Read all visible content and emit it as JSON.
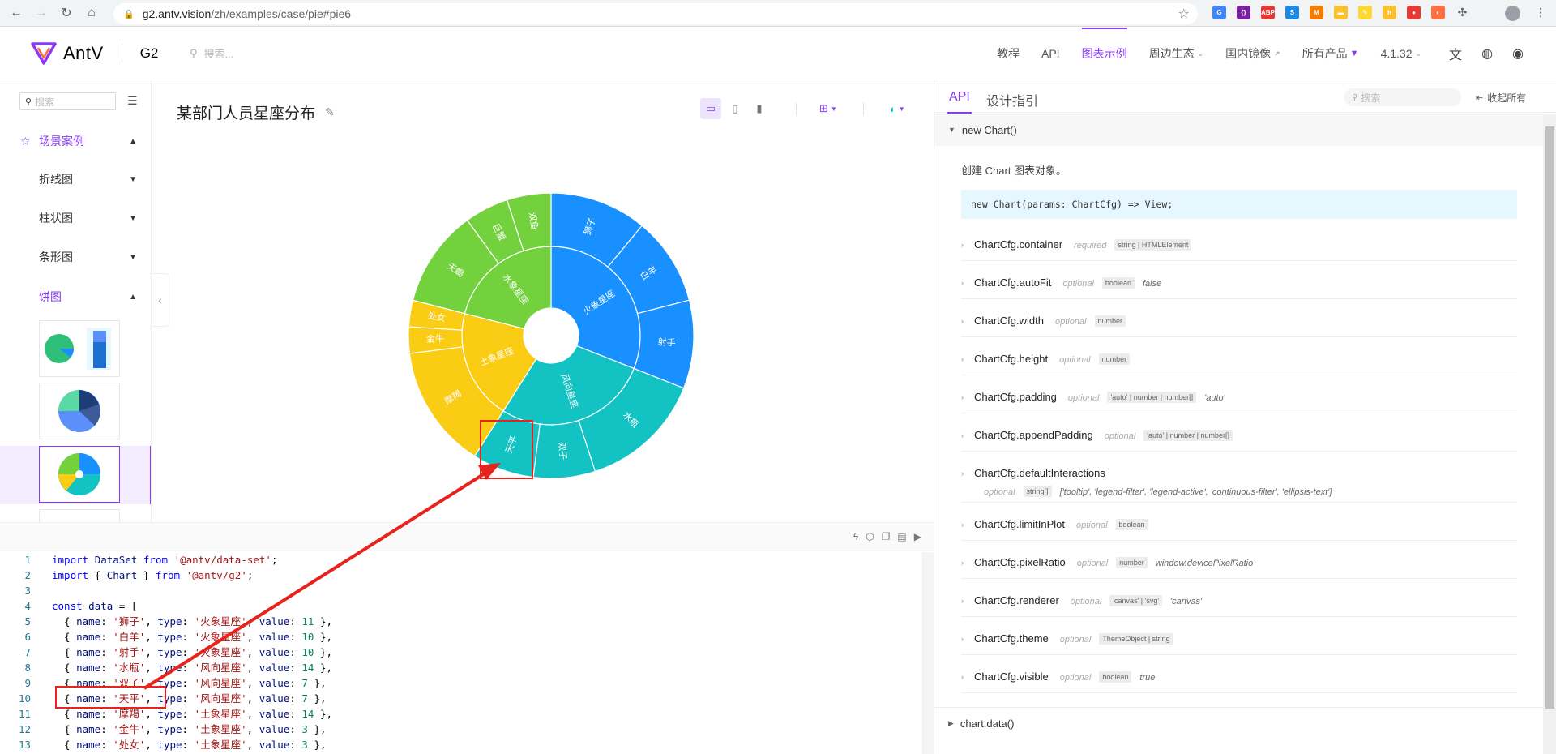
{
  "browser": {
    "url_host": "g2.antv.vision",
    "url_path": "/zh/examples/case/pie#pie6",
    "extensions": [
      {
        "name": "translate-ext",
        "color": "#4285f4",
        "label": "G"
      },
      {
        "name": "json-ext",
        "color": "#7b1fa2",
        "label": "{}"
      },
      {
        "name": "adblock-ext",
        "color": "#e53935",
        "label": "ABP"
      },
      {
        "name": "screenshot-ext",
        "color": "#1e88e5",
        "label": "S"
      },
      {
        "name": "metamask-ext",
        "color": "#f57c00",
        "label": "M"
      },
      {
        "name": "tab-ext",
        "color": "#fbc02d",
        "label": "▬"
      },
      {
        "name": "pen-ext",
        "color": "#fdd835",
        "label": "✎"
      },
      {
        "name": "code-ext",
        "color": "#fbc02d",
        "label": "h"
      },
      {
        "name": "dice-ext",
        "color": "#e53935",
        "label": "●"
      },
      {
        "name": "chart-ext",
        "color": "#ff7043",
        "label": "◐"
      }
    ]
  },
  "header": {
    "brand": "AntV",
    "product": "G2",
    "search_placeholder": "搜索...",
    "nav": [
      {
        "label": "教程",
        "active": false
      },
      {
        "label": "API",
        "active": false
      },
      {
        "label": "图表示例",
        "active": true
      },
      {
        "label": "周边生态",
        "active": false,
        "dropdown": true
      },
      {
        "label": "国内镜像",
        "active": false,
        "external": true
      },
      {
        "label": "所有产品",
        "active": false,
        "badge": true
      },
      {
        "label": "4.1.32",
        "active": false,
        "dropdown": true
      }
    ]
  },
  "sidebar": {
    "search_placeholder": "搜索",
    "root": "场景案例",
    "groups": [
      "折线图",
      "柱状图",
      "条形图"
    ],
    "open_group": "饼图"
  },
  "demo": {
    "title": "某部门人员星座分布"
  },
  "chart_data": {
    "type": "pie",
    "inner": [
      {
        "name": "火象星座",
        "value": 31,
        "color": "#1890ff"
      },
      {
        "name": "风向星座",
        "value": 28,
        "color": "#13c2c2"
      },
      {
        "name": "土象星座",
        "value": 20,
        "color": "#facc14"
      },
      {
        "name": "水象星座",
        "value": 21,
        "color": "#73d13d"
      }
    ],
    "outer": [
      {
        "name": "狮子",
        "type": "火象星座",
        "value": 11
      },
      {
        "name": "白羊",
        "type": "火象星座",
        "value": 10
      },
      {
        "name": "射手",
        "type": "火象星座",
        "value": 10
      },
      {
        "name": "水瓶",
        "type": "风向星座",
        "value": 14
      },
      {
        "name": "双子",
        "type": "风向星座",
        "value": 7
      },
      {
        "name": "天平",
        "type": "风向星座",
        "value": 7
      },
      {
        "name": "摩羯",
        "type": "土象星座",
        "value": 14
      },
      {
        "name": "金牛",
        "type": "土象星座",
        "value": 3
      },
      {
        "name": "处女",
        "type": "土象星座",
        "value": 3
      },
      {
        "name": "天蝎",
        "type": "水象星座",
        "value": 11
      },
      {
        "name": "巨蟹",
        "type": "水象星座",
        "value": 5
      },
      {
        "name": "双鱼",
        "type": "水象星座",
        "value": 5
      }
    ]
  },
  "code": {
    "lines": [
      {
        "n": "1",
        "html": "<span class='kw'>import</span> <span class='prop'>DataSet</span> <span class='kw'>from</span> <span class='str'>'@antv/data-set'</span>;"
      },
      {
        "n": "2",
        "html": "<span class='kw'>import</span> { <span class='prop'>Chart</span> } <span class='kw'>from</span> <span class='str'>'@antv/g2'</span>;"
      },
      {
        "n": "3",
        "html": ""
      },
      {
        "n": "4",
        "html": "<span class='kw'>const</span> <span class='prop'>data</span> = ["
      },
      {
        "n": "5",
        "html": "  { <span class='prop'>name</span>: <span class='str'>'狮子'</span>, <span class='prop'>type</span>: <span class='str'>'火象星座'</span>, <span class='prop'>value</span>: <span class='num'>11</span> },"
      },
      {
        "n": "6",
        "html": "  { <span class='prop'>name</span>: <span class='str'>'白羊'</span>, <span class='prop'>type</span>: <span class='str'>'火象星座'</span>, <span class='prop'>value</span>: <span class='num'>10</span> },"
      },
      {
        "n": "7",
        "html": "  { <span class='prop'>name</span>: <span class='str'>'射手'</span>, <span class='prop'>type</span>: <span class='str'>'火象星座'</span>, <span class='prop'>value</span>: <span class='num'>10</span> },"
      },
      {
        "n": "8",
        "html": "  { <span class='prop'>name</span>: <span class='str'>'水瓶'</span>, <span class='prop'>type</span>: <span class='str'>'风向星座'</span>, <span class='prop'>value</span>: <span class='num'>14</span> },"
      },
      {
        "n": "9",
        "html": "  { <span class='prop'>name</span>: <span class='str'>'双子'</span>, <span class='prop'>type</span>: <span class='str'>'风向星座'</span>, <span class='prop'>value</span>: <span class='num'>7</span> },"
      },
      {
        "n": "10",
        "html": "  { <span class='prop'>name</span>: <span class='str'>'天平'</span>, <span class='prop'>type</span>: <span class='str'>'风向星座'</span>, <span class='prop'>value</span>: <span class='num'>7</span> },"
      },
      {
        "n": "11",
        "html": "  { <span class='prop'>name</span>: <span class='str'>'摩羯'</span>, <span class='prop'>type</span>: <span class='str'>'土象星座'</span>, <span class='prop'>value</span>: <span class='num'>14</span> },"
      },
      {
        "n": "12",
        "html": "  { <span class='prop'>name</span>: <span class='str'>'金牛'</span>, <span class='prop'>type</span>: <span class='str'>'土象星座'</span>, <span class='prop'>value</span>: <span class='num'>3</span> },"
      },
      {
        "n": "13",
        "html": "  { <span class='prop'>name</span>: <span class='str'>'处女'</span>, <span class='prop'>type</span>: <span class='str'>'土象星座'</span>, <span class='prop'>value</span>: <span class='num'>3</span> },"
      }
    ]
  },
  "api": {
    "tabs": [
      "API",
      "设计指引"
    ],
    "search_placeholder": "搜索",
    "collapse_all": "收起所有",
    "section": "new Chart()",
    "desc": "创建 Chart 图表对象。",
    "signature": "new Chart(params: ChartCfg) => View;",
    "rows": [
      {
        "name": "ChartCfg.container",
        "opt": "required",
        "type": "string | HTMLElement",
        "dflt": ""
      },
      {
        "name": "ChartCfg.autoFit",
        "opt": "optional",
        "type": "boolean",
        "dflt": "false"
      },
      {
        "name": "ChartCfg.width",
        "opt": "optional",
        "type": "number",
        "dflt": ""
      },
      {
        "name": "ChartCfg.height",
        "opt": "optional",
        "type": "number",
        "dflt": ""
      },
      {
        "name": "ChartCfg.padding",
        "opt": "optional",
        "type": "'auto' | number | number[]",
        "dflt": "'auto'"
      },
      {
        "name": "ChartCfg.appendPadding",
        "opt": "optional",
        "type": "'auto' | number | number[]",
        "dflt": ""
      },
      {
        "name": "ChartCfg.defaultInteractions",
        "opt": "optional",
        "type": "string[]",
        "dflt": "['tooltip', 'legend-filter', 'legend-active', 'continuous-filter', 'ellipsis-text']",
        "wrap": true
      },
      {
        "name": "ChartCfg.limitInPlot",
        "opt": "optional",
        "type": "boolean",
        "dflt": ""
      },
      {
        "name": "ChartCfg.pixelRatio",
        "opt": "optional",
        "type": "number",
        "dflt": "window.devicePixelRatio"
      },
      {
        "name": "ChartCfg.renderer",
        "opt": "optional",
        "type": "'canvas' | 'svg'",
        "dflt": "'canvas'"
      },
      {
        "name": "ChartCfg.theme",
        "opt": "optional",
        "type": "ThemeObject | string",
        "dflt": ""
      },
      {
        "name": "ChartCfg.visible",
        "opt": "optional",
        "type": "boolean",
        "dflt": "true"
      }
    ],
    "next_section": "chart.data()"
  }
}
